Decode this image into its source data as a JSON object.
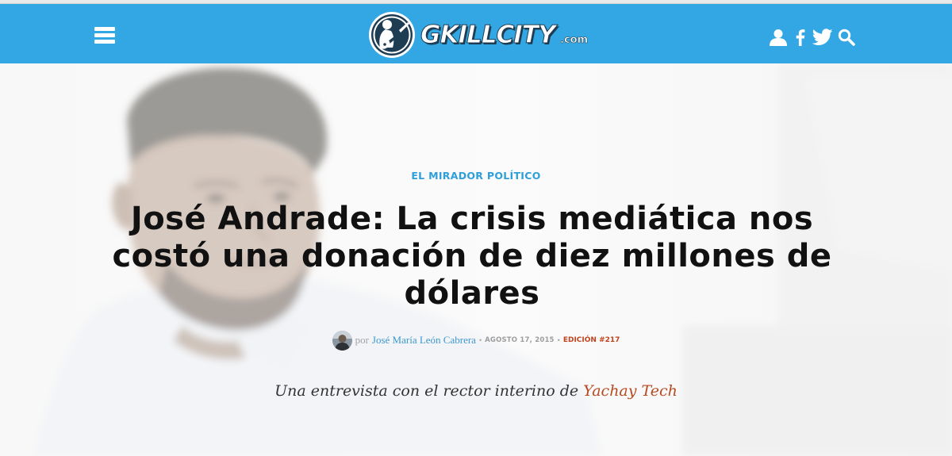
{
  "navbar": {
    "menu_icon": "hamburger-menu-icon",
    "logo_text": "GKILLCITY",
    "logo_domain": ".com",
    "icons": [
      "user-icon",
      "facebook-icon",
      "twitter-icon",
      "search-icon"
    ],
    "background_color": "#33a7e3"
  },
  "article": {
    "category": "EL MIRADOR POLÍTICO",
    "title_lines": [
      "José Andrade: La crisis mediática nos",
      "costó una donación de diez millones de",
      "dólares"
    ],
    "byline": {
      "prefix": "por",
      "author": "José María León Cabrera",
      "separator": "•",
      "date": "AGOSTO 17, 2015",
      "edition": "EDICIÓN #217"
    },
    "dek": {
      "text": "Una entrevista con el rector interino de ",
      "link_text": "Yachay Tech"
    }
  },
  "colors": {
    "accent_blue": "#33a7e3",
    "category_blue": "#2e9fd9",
    "edition_red": "#c1431d",
    "link_rust": "#b64a22"
  }
}
